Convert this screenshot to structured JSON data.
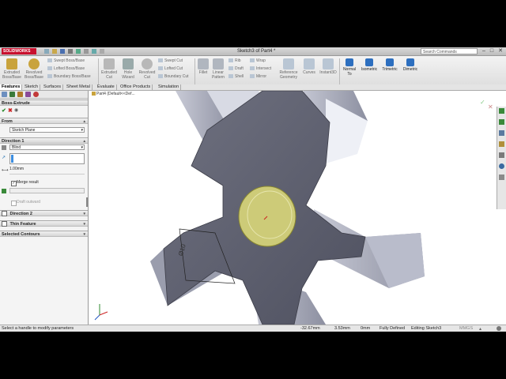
{
  "window": {
    "app_name": "SOLIDWORKS",
    "title": "Sketch3 of Part4 *",
    "search_placeholder": "Search Commands",
    "min": "–",
    "max": "□",
    "close": "✕"
  },
  "command_manager": {
    "extruded_boss": "Extruded Boss/Base",
    "revolved_boss": "Revolved Boss/Base",
    "swept_boss": "Swept Boss/Base",
    "lofted_boss": "Lofted Boss/Base",
    "boundary_boss": "Boundary Boss/Base",
    "extruded_cut": "Extruded Cut",
    "hole_wizard": "Hole Wizard",
    "revolved_cut": "Revolved Cut",
    "swept_cut": "Swept Cut",
    "lofted_cut": "Lofted Cut",
    "boundary_cut": "Boundary Cut",
    "fillet": "Fillet",
    "linear_pattern": "Linear Pattern",
    "rib": "Rib",
    "draft": "Draft",
    "shell": "Shell",
    "wrap": "Wrap",
    "intersect": "Intersect",
    "mirror": "Mirror",
    "reference_geometry": "Reference Geometry",
    "curves": "Curves",
    "instant3d": "Instant3D",
    "normal_to": "Normal To",
    "isometric": "Isometric",
    "trimetric": "Trimetric",
    "dimetric": "Dimetric"
  },
  "tabs": [
    "Features",
    "Sketch",
    "Surfaces",
    "Sheet Metal",
    "Evaluate",
    "Office Products",
    "Simulation"
  ],
  "panel": {
    "title": "Boss-Extrude",
    "from_header": "From",
    "from_value": "Sketch Plane",
    "direction1_header": "Direction 1",
    "direction1_type": "Blind",
    "depth": "1.00mm",
    "merge_result": "Merge result",
    "draft_outward": "Draft outward",
    "direction2_header": "Direction 2",
    "thin_feature_header": "Thin Feature",
    "selected_contours_header": "Selected Contours"
  },
  "viewport": {
    "tree_label": "Part4 (Default<<Def...",
    "dimension": "Ø10"
  },
  "status": {
    "message": "Select a handle to modify parameters",
    "x": "-32.67mm",
    "y": "3.53mm",
    "z": "0mm",
    "state": "Fully Defined",
    "editing": "Editing Sketch3",
    "units": "MMGS"
  },
  "colors": {
    "accent": "#1f6fb2",
    "brand": "#c8102e",
    "part_face": "#5d5f6e",
    "part_face_light": "#a9acbc",
    "sketch_circle": "#cdcb78"
  }
}
